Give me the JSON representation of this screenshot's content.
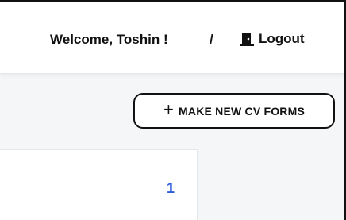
{
  "header": {
    "welcome_text": "Welcome, Toshin !",
    "separator": "/",
    "logout_label": "Logout",
    "logout_icon": "door-exit-icon"
  },
  "actions": {
    "make_new_label": "MAKE NEW CV FORMS",
    "make_new_icon": "plus-icon"
  },
  "card": {
    "count": "1"
  },
  "colors": {
    "accent": "#2f5bd8",
    "border": "#111111",
    "background": "#f4f6f8"
  }
}
